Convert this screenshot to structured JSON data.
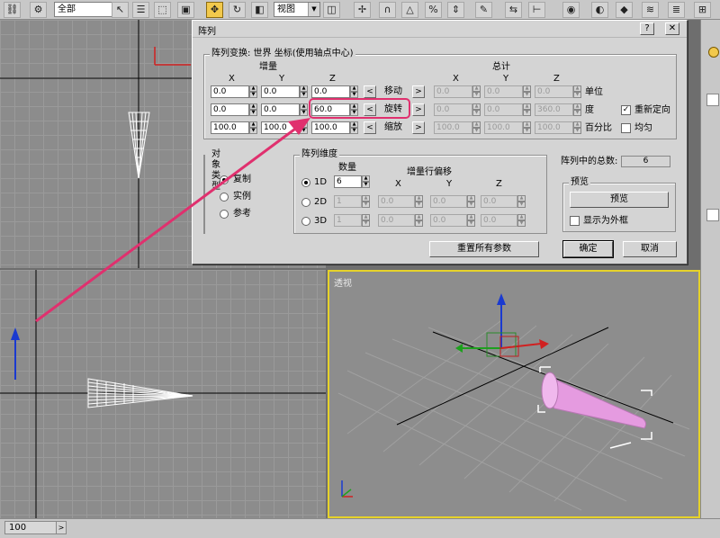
{
  "toolbar": {
    "selection_filter": "全部",
    "reference_coord": "视图"
  },
  "viewports": {
    "perspective_label": "透视"
  },
  "status": {
    "frame_value": "100"
  },
  "dialog": {
    "title": "阵列",
    "help_button": "?",
    "close_button": "✕",
    "transform_group_title": "阵列变换: 世界 坐标(使用轴点中心)",
    "increment_label": "增量",
    "total_label": "总计",
    "axis_x": "X",
    "axis_y": "Y",
    "axis_z": "Z",
    "move_label": "移动",
    "rotate_label": "旋转",
    "scale_label": "缩放",
    "units_label": "单位",
    "degrees_label": "度",
    "percent_label": "百分比",
    "reorient_label": "重新定向",
    "uniform_label": "均匀",
    "left_arrow": "<",
    "right_arrow": ">",
    "move_inc": {
      "x": "0.0",
      "y": "0.0",
      "z": "0.0"
    },
    "rotate_inc": {
      "x": "0.0",
      "y": "0.0",
      "z": "60.0"
    },
    "scale_inc": {
      "x": "100.0",
      "y": "100.0",
      "z": "100.0"
    },
    "move_total": {
      "x": "0.0",
      "y": "0.0",
      "z": "0.0"
    },
    "rotate_total": {
      "x": "0.0",
      "y": "0.0",
      "z": "360.0"
    },
    "scale_total": {
      "x": "100.0",
      "y": "100.0",
      "z": "100.0"
    },
    "object_type_title": "对象类型",
    "copy_label": "复制",
    "instance_label": "实例",
    "reference_label": "参考",
    "array_dim_title": "阵列维度",
    "count_label": "数量",
    "incr_row_offset_label": "增量行偏移",
    "dim_1d": "1D",
    "dim_2d": "2D",
    "dim_3d": "3D",
    "count_1d": "6",
    "count_2d": "1",
    "count_3d": "1",
    "offset_2d": {
      "x": "0.0",
      "y": "0.0",
      "z": "0.0"
    },
    "offset_3d": {
      "x": "0.0",
      "y": "0.0",
      "z": "0.0"
    },
    "total_in_array_label": "阵列中的总数:",
    "total_in_array_value": "6",
    "preview_group_title": "预览",
    "preview_button": "预览",
    "show_as_box_label": "显示为外框",
    "reset_button": "重置所有参数",
    "ok_button": "确定",
    "cancel_button": "取消"
  },
  "colors": {
    "highlight": "#e0306e",
    "perspective_border": "#e6d22a",
    "cone": "#e59be0"
  }
}
